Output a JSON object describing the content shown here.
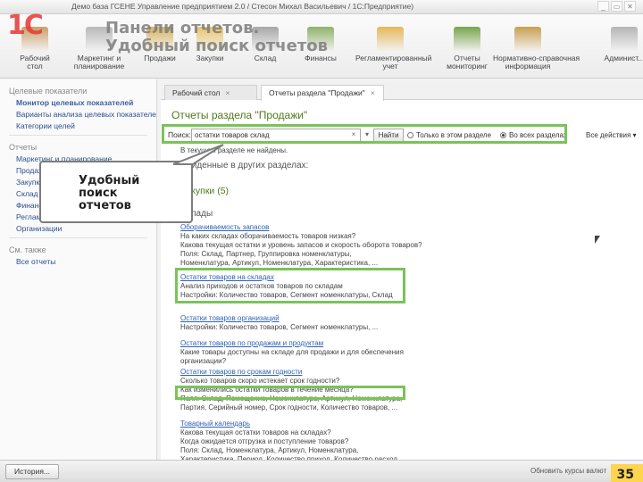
{
  "window": {
    "title": "Демо база ГСЕНЕ Управление предприятием 2.0 / Стесон Михал Васильевич / 1С:Предприятие)",
    "controls": [
      "_",
      "▭",
      "✕"
    ]
  },
  "logo": {
    "text": "1С"
  },
  "slide": {
    "title": "Панели отчетов.\nУдобный поиск отчетов",
    "callout": "Удобный\nпоиск\nотчетов",
    "page_number": "35"
  },
  "toolbar": {
    "items": [
      {
        "label": "Рабочий\nстол",
        "color": "#c9a06a"
      },
      {
        "label": "Маркетинг и\nпланирование",
        "color": "#b8b8b8"
      },
      {
        "label": "Продажи",
        "color": "#d6b360"
      },
      {
        "label": "Закупки",
        "color": "#e9c46a"
      },
      {
        "label": "Склад",
        "color": "#a7a7a7"
      },
      {
        "label": "Финансы",
        "color": "#8fb36a"
      },
      {
        "label": "Регламентированный\nучет",
        "color": "#e6b85a"
      },
      {
        "label": "Отчеты\nмониторинг",
        "color": "#78a44c"
      },
      {
        "label": "Нормативно-справочная\nинформация",
        "color": "#c8a050"
      },
      {
        "label": "Админист...",
        "color": "#b5b5b5"
      }
    ]
  },
  "sidebar": {
    "section1": "Целевые показатели",
    "items1": [
      "Монитор целевых показателей",
      "Варианты анализа целевых показателей",
      "Категории целей"
    ],
    "section2": "Отчеты",
    "items2": [
      "Маркетинг и планирование",
      "Продажи",
      "Закупки",
      "Склад",
      "Финансы",
      "Регламентированный учет",
      "Организации"
    ],
    "section3": "См. также",
    "items3": [
      "Все отчеты"
    ]
  },
  "tabs": [
    {
      "label": "Рабочий стол"
    },
    {
      "label": "Отчеты раздела \"Продажи\""
    }
  ],
  "report": {
    "title": "Отчеты раздела \"Продажи\"",
    "search_label": "Поиск:",
    "search_value": "остатки товаров склад",
    "find_button": "Найти",
    "radio_this": "Только в этом разделе",
    "radio_all": "Во всех разделах",
    "all_actions": "Все действия ▾",
    "no_found": "В текущем разделе не найдены.",
    "found_other": "Найденные в других разделах:",
    "group": "Закупки (5)",
    "subgroup": "Склады",
    "entries": [
      {
        "title": "Оборачиваемость запасов",
        "lines": [
          "На каких складах оборачиваемость товаров низкая?",
          "Какова текущая остатки и уровень запасов и скорость оборота товаров?",
          "Поля: Склад, Партнер, Группировка номенклатуры,",
          "Номенклатура, Артикул, Номенклатура, Характеристика, ..."
        ]
      },
      {
        "title": "Остатки товаров на складах",
        "lines": [
          "Анализ приходов и остатков товаров по складам",
          "Настройки: Количество товаров, Сегмент номенклатуры, Склад"
        ]
      },
      {
        "title": "Остатки товаров организаций",
        "lines": [
          "Настройки: Количество товаров, Сегмент номенклатуры, ..."
        ]
      },
      {
        "title": "Остатки товаров по продажам и продуктам",
        "lines": [
          "Какие товары доступны на складе для продажи и для обеспечения",
          "организации?"
        ]
      },
      {
        "title": "Остатки товаров по срокам годности",
        "lines": [
          "Сколько товаров скоро истекает срок годности?",
          "Как изменились остатки товаров в течение месяца?",
          "Поля: Склад, Помещение, Номенклатура, Артикул, Номенклатура,",
          "Партия, Серийный номер, Срок годности, Количество товаров, ..."
        ]
      },
      {
        "title": "Товарный календарь",
        "lines": [
          "Какова текущая остатки товаров на складах?",
          "Когда ожидается отгрузка и поступление товаров?",
          "Поля: Склад, Номенклатура, Артикул, Номенклатура,",
          "Характеристика, Период, Количество приход, Количество расход, ..."
        ]
      }
    ]
  },
  "statusbar": {
    "history": "История...",
    "right_text": "Обновить курсы валют"
  }
}
